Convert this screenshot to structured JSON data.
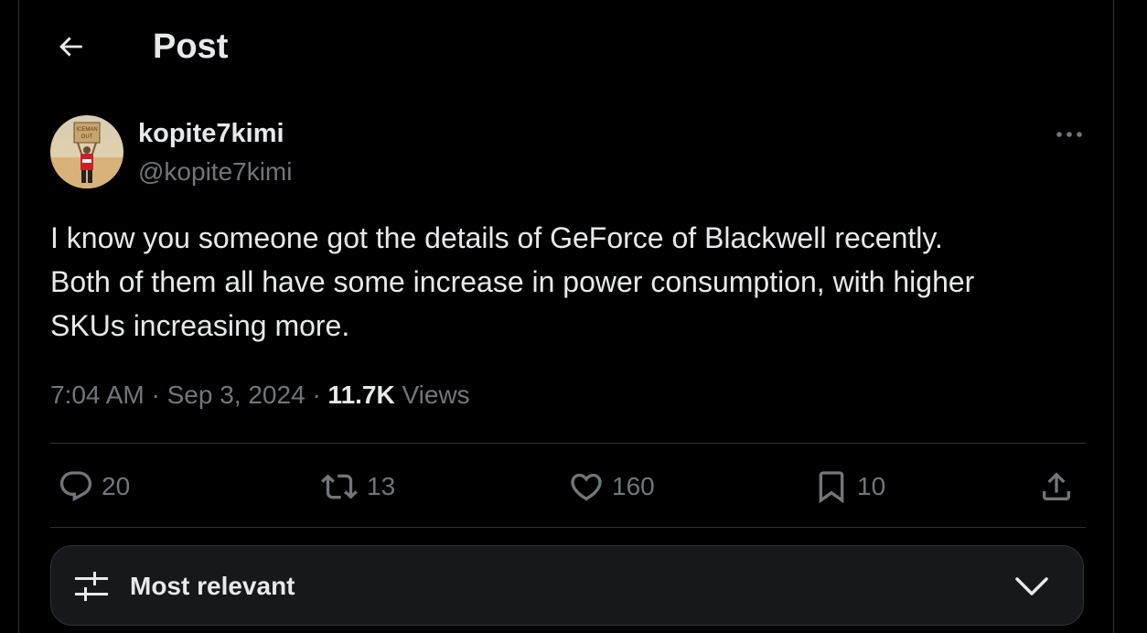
{
  "header": {
    "title": "Post",
    "back_icon": "arrow-left-icon"
  },
  "author": {
    "display_name": "kopite7kimi",
    "handle": "@kopite7kimi",
    "avatar_sign_text": "ICEMAN OUT"
  },
  "tweet": {
    "text": "I know you someone got the details of GeForce of Blackwell recently.\nBoth of them all have some increase in power consumption, with higher\nSKUs increasing more.",
    "time": "7:04 AM",
    "separator": "·",
    "date": "Sep 3, 2024",
    "views_count": "11.7K",
    "views_label": "Views"
  },
  "actions": {
    "replies": "20",
    "reposts": "13",
    "likes": "160",
    "bookmarks": "10"
  },
  "sort": {
    "label": "Most relevant"
  },
  "colors": {
    "background": "#000000",
    "text_primary": "#e7e9ea",
    "text_secondary": "#71767b",
    "border": "#2f3336",
    "sort_bar_bg": "#16181c"
  }
}
